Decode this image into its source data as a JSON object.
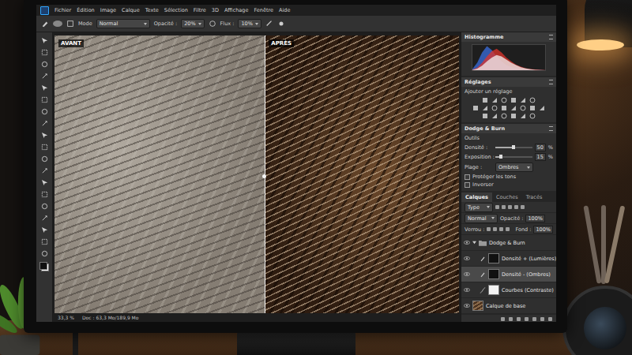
{
  "app": {
    "menu": [
      "Fichier",
      "Édition",
      "Image",
      "Calque",
      "Texte",
      "Sélection",
      "Filtre",
      "3D",
      "Affichage",
      "Fenêtre",
      "Aide"
    ]
  },
  "options_bar": {
    "mode_label": "Mode",
    "mode": "Normal",
    "opacity_label": "Opacité :",
    "opacity": "20%",
    "flow_label": "Flux :",
    "flow": "10%"
  },
  "canvas": {
    "before_label": "AVANT",
    "after_label": "APRÈS"
  },
  "status_bar": {
    "zoom": "33,3 %",
    "doc": "Doc : 63,3 Mo/189,9 Mo"
  },
  "histogram": {
    "title": "Histogramme",
    "series": [
      {
        "color": "#3b6fe0",
        "values": [
          5,
          30,
          70,
          95,
          80,
          55,
          35,
          20,
          12,
          8,
          5,
          3,
          2,
          1,
          1,
          0
        ]
      },
      {
        "color": "#e0342c",
        "values": [
          2,
          10,
          30,
          55,
          75,
          85,
          70,
          50,
          35,
          22,
          14,
          8,
          5,
          3,
          2,
          1
        ]
      },
      {
        "color": "#f2f2f2",
        "values": [
          1,
          6,
          18,
          35,
          50,
          60,
          55,
          42,
          30,
          20,
          12,
          7,
          4,
          2,
          1,
          0
        ]
      }
    ]
  },
  "adjustments": {
    "title": "Réglages",
    "hint": "Ajouter un réglage"
  },
  "dodge_burn": {
    "title": "Dodge & Burn",
    "section": "Outils",
    "sliders": [
      {
        "label": "Densité :",
        "value": "50",
        "unit": "%",
        "level": 0.5
      },
      {
        "label": "Exposition :",
        "value": "15",
        "unit": "%",
        "level": 0.15
      }
    ],
    "range_label": "Plage :",
    "range": "Ombres",
    "checkboxes": [
      {
        "label": "Protéger les tons",
        "checked": false
      },
      {
        "label": "Inverser",
        "checked": false
      }
    ]
  },
  "layers_panel": {
    "tabs": [
      {
        "label": "Calques",
        "selected": true
      },
      {
        "label": "Couches",
        "selected": false
      },
      {
        "label": "Tracés",
        "selected": false
      }
    ],
    "filter": "Type",
    "blend_mode": "Normal",
    "opacity_label": "Opacité :",
    "opacity": "100%",
    "lock_label": "Verrou :",
    "fill_label": "Fond :",
    "fill": "100%",
    "layers": [
      {
        "name": "Dodge & Burn",
        "kind": "group",
        "visible": true,
        "selected": false,
        "expanded": true
      },
      {
        "name": "Densité + (Lumières)",
        "kind": "density",
        "visible": true,
        "selected": false
      },
      {
        "name": "Densité - (Ombres)",
        "kind": "density",
        "visible": true,
        "selected": true
      },
      {
        "name": "Courbes (Contraste)",
        "kind": "curves",
        "visible": true,
        "selected": false
      },
      {
        "name": "Calque de base",
        "kind": "image",
        "visible": true,
        "selected": false
      }
    ]
  }
}
